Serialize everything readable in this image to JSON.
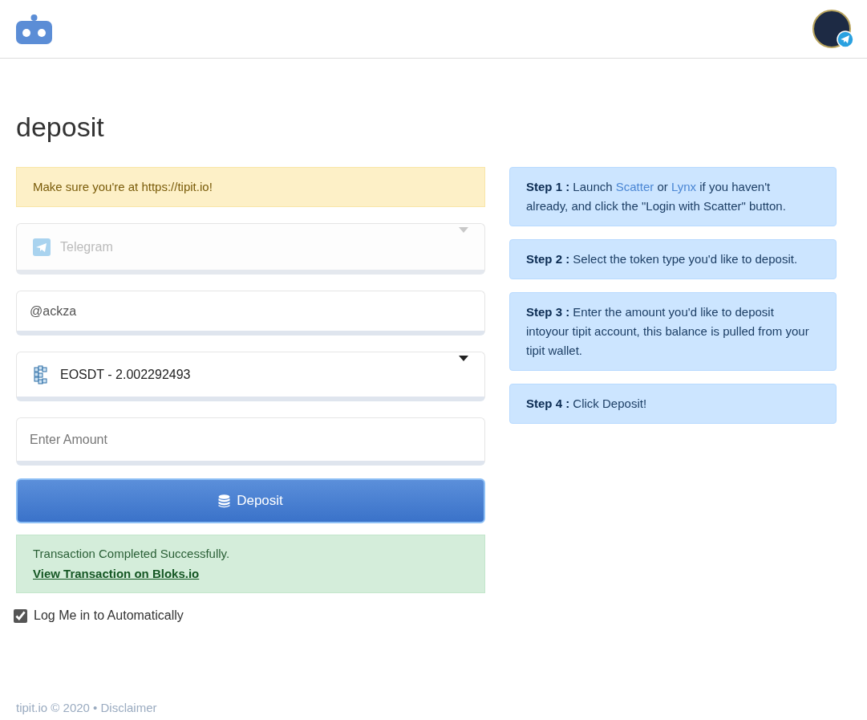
{
  "page_title": "deposit",
  "warning": "Make sure you're at https://tipit.io!",
  "platform_select": {
    "value": "Telegram",
    "disabled": true
  },
  "username_field": {
    "value": "@ackza"
  },
  "token_select": {
    "value": "EOSDT - 2.002292493",
    "disabled": false
  },
  "amount_field": {
    "placeholder": "Enter Amount"
  },
  "deposit_button": "Deposit",
  "success": {
    "message": "Transaction Completed Successfully.",
    "link": "View Transaction on Bloks.io"
  },
  "auto_login": {
    "label": "Log Me in to Automatically",
    "checked": true
  },
  "steps": [
    {
      "label": "Step 1 :",
      "segments": [
        {
          "kind": "text",
          "text": " Launch "
        },
        {
          "kind": "link",
          "text": "Scatter"
        },
        {
          "kind": "text",
          "text": " or "
        },
        {
          "kind": "link",
          "text": "Lynx"
        },
        {
          "kind": "text",
          "text": " if you haven't already, and click the \"Login with Scatter\" button."
        }
      ]
    },
    {
      "label": "Step 2 :",
      "segments": [
        {
          "kind": "text",
          "text": " Select the token type you'd like to deposit."
        }
      ]
    },
    {
      "label": "Step 3 :",
      "segments": [
        {
          "kind": "text",
          "text": " Enter the amount you'd like to deposit intoyour tipit account, this balance is pulled from your tipit wallet."
        }
      ]
    },
    {
      "label": "Step 4 :",
      "segments": [
        {
          "kind": "text",
          "text": " Click Deposit!"
        }
      ]
    }
  ],
  "footer": "tipit.io © 2020 • Disclaimer"
}
